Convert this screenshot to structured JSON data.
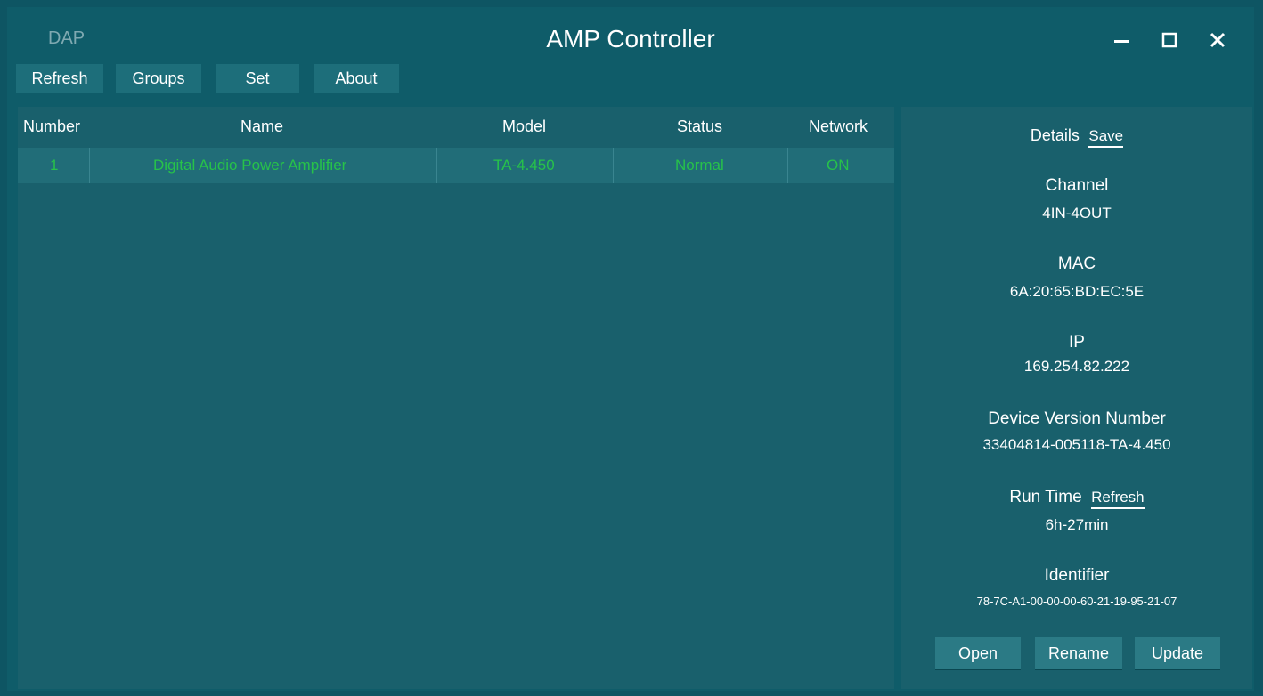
{
  "window": {
    "brand": "DAP",
    "title": "AMP Controller"
  },
  "toolbar": {
    "refresh_label": "Refresh",
    "groups_label": "Groups",
    "set_label": "Set",
    "about_label": "About"
  },
  "table": {
    "columns": [
      "Number",
      "Name",
      "Model",
      "Status",
      "Network"
    ],
    "rows": [
      {
        "number": "1",
        "name": "Digital Audio Power Amplifier",
        "model": "TA-4.450",
        "status": "Normal",
        "network": "ON"
      }
    ]
  },
  "details": {
    "title": "Details",
    "save_label": "Save",
    "channel_label": "Channel",
    "channel_value": "4IN-4OUT",
    "mac_label": "MAC",
    "mac_value": "6A:20:65:BD:EC:5E",
    "ip_label": "IP",
    "ip_value": "169.254.82.222",
    "version_label": "Device Version Number",
    "version_value": "33404814-005118-TA-4.450",
    "runtime_label": "Run Time",
    "runtime_refresh_label": "Refresh",
    "runtime_value": "6h-27min",
    "identifier_label": "Identifier",
    "identifier_value": "78-7C-A1-00-00-00-60-21-19-95-21-07",
    "open_label": "Open",
    "rename_label": "Rename",
    "update_label": "Update"
  },
  "colors": {
    "background": "#0f5c69",
    "panel": "#19606c",
    "row_highlight": "#216d78",
    "row_text": "#27c24a"
  },
  "icons": {
    "minimize": "minimize-icon",
    "maximize": "maximize-icon",
    "close": "close-icon"
  }
}
